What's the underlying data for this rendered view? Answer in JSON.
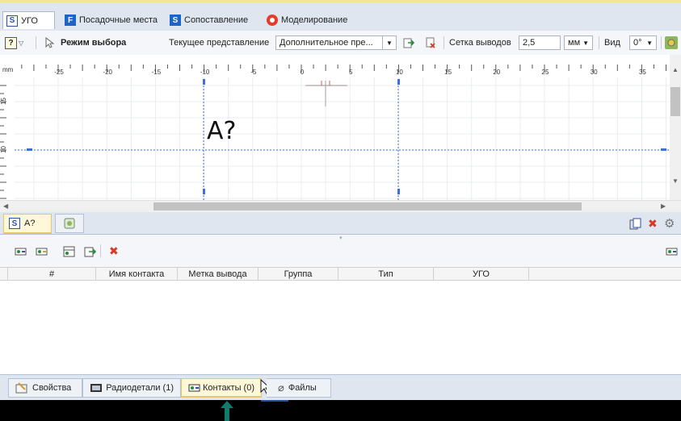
{
  "top_tabs": [
    {
      "label": "УГО",
      "icon": "S",
      "active": true
    },
    {
      "label": "Посадочные места",
      "icon": "F",
      "active": false
    },
    {
      "label": "Сопоставление",
      "icon": "S",
      "active": false
    },
    {
      "label": "Моделирование",
      "icon": "model-icon",
      "active": false
    }
  ],
  "toolbar": {
    "mode_label": "Режим выбора",
    "representation_label": "Текущее представление",
    "representation_value": "Дополнительное пре...",
    "grid_label": "Сетка выводов",
    "grid_value": "2,5",
    "unit_value": "мм",
    "view_label": "Вид",
    "rotation_value": "0°"
  },
  "ruler": {
    "unit": "mm",
    "h_ticks": [
      "-25",
      "-20",
      "-15",
      "-10",
      "-5",
      "0",
      "5",
      "10",
      "15",
      "20",
      "25",
      "30",
      "35"
    ],
    "v_ticks": [
      "15",
      "10"
    ]
  },
  "drawing": {
    "designator_text": "А?"
  },
  "doc_tabs": [
    {
      "label": "А?",
      "icon": "S",
      "active": true
    },
    {
      "label": "",
      "icon": "preview-icon",
      "active": false
    }
  ],
  "contacts_grid": {
    "columns": [
      "#",
      "Имя контакта",
      "Метка вывода",
      "Группа",
      "Тип",
      "УГО"
    ],
    "rows": []
  },
  "bottom_tabs": [
    {
      "label": "Свойства",
      "icon": "properties-icon",
      "active": false
    },
    {
      "label": "Радиодетали (1)",
      "icon": "parts-icon",
      "active": false
    },
    {
      "label": "Контакты (0)",
      "icon": "contacts-icon",
      "active": true
    },
    {
      "label": "Файлы",
      "icon": "clip-icon",
      "active": false
    }
  ],
  "colors": {
    "accent_blue": "#3b6fd9",
    "red_close": "#d83a2a",
    "arrow_teal": "#0f7d6a"
  }
}
